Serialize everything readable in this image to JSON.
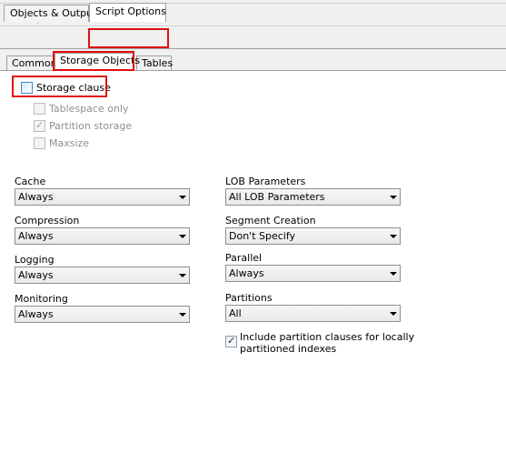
{
  "toolbar": {
    "icons": [
      "wand-dropdown-icon",
      "chevron-down-icon",
      "run-icon",
      "cancel-icon"
    ],
    "run_color": "#1aa31a"
  },
  "outer_tabs": [
    {
      "label": "Objects & Output",
      "active": false
    },
    {
      "label": "Script Options",
      "active": true
    }
  ],
  "inner_tabs": [
    {
      "label": "Common",
      "active": false
    },
    {
      "label": "Storage Objects",
      "active": true
    },
    {
      "label": "Tables",
      "active": false
    }
  ],
  "storage": {
    "storage_clause": {
      "label": "Storage clause",
      "checked": false
    },
    "tablespace_only": {
      "label": "Tablespace only",
      "checked": false,
      "enabled": false
    },
    "partition_storage": {
      "label": "Partition storage",
      "checked": true,
      "enabled": false
    },
    "maxsize": {
      "label": "Maxsize",
      "checked": false,
      "enabled": false
    }
  },
  "left_fields": [
    {
      "label": "Cache",
      "value": "Always"
    },
    {
      "label": "Compression",
      "value": "Always"
    },
    {
      "label": "Logging",
      "value": "Always"
    },
    {
      "label": "Monitoring",
      "value": "Always"
    }
  ],
  "right_fields": [
    {
      "label": "LOB Parameters",
      "value": "All LOB Parameters"
    },
    {
      "label": "Segment Creation",
      "value": "Don't Specify"
    },
    {
      "label": "Parallel",
      "value": "Always"
    },
    {
      "label": "Partitions",
      "value": "All"
    }
  ],
  "include_partition": {
    "label": "Include partition clauses for locally partitioned indexes",
    "line1": "Include partition clauses for locally",
    "line2": "partitioned indexes",
    "checked": true
  },
  "colors": {
    "highlight": "#e01010",
    "panel": "#f0f0f0"
  }
}
